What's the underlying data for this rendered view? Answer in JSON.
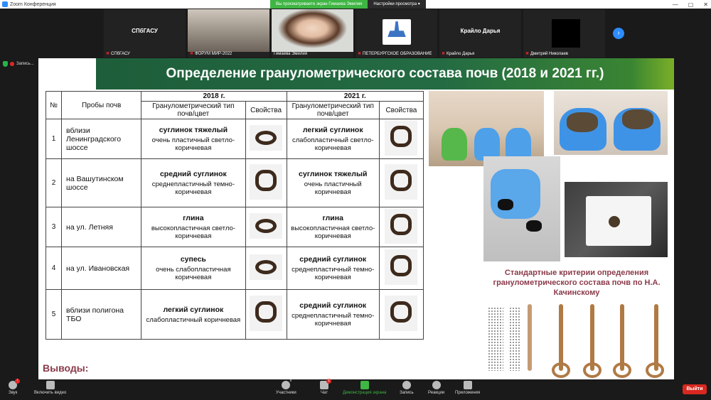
{
  "window": {
    "title": "Zoom Конференция"
  },
  "share_banner": {
    "text": "Вы просматриваете экран Гимаева Эмилия",
    "options_label": "Настройки просмотра ▾"
  },
  "window_controls": {
    "minimize": "—",
    "maximize": "▢",
    "close": "✕"
  },
  "gallery": {
    "tiles": [
      {
        "center_name": "СПбГАСУ",
        "label": "СПбГАСУ"
      },
      {
        "center_name": "",
        "label": "ФОРУМ МИР-2022"
      },
      {
        "center_name": "",
        "label": "Гимаева Эмилия"
      },
      {
        "center_name": "",
        "label": "ПЕТЕРБУРГСКОЕ ОБРАЗОВАНИЕ",
        "logo_text": "ПЕТЕРБУРГСКОЕ ОБРАЗОВАНИЕ"
      },
      {
        "center_name": "Крайло Дарья",
        "label": "Крайло Дарья"
      },
      {
        "center_name": "",
        "label": "Дмитрий Николаев"
      }
    ],
    "next_icon": "›"
  },
  "recording": {
    "label": "Запись..."
  },
  "slide": {
    "title": "Определение гранулометрического состава почв (2018 и 2021 гг.)",
    "table": {
      "head_no": "№",
      "head_samples": "Пробы почв",
      "year_2018": "2018 г.",
      "year_2021": "2021 г.",
      "sub_type": "Гранулометрический тип почв/цвет",
      "sub_props": "Свойства",
      "rows": [
        {
          "no": "1",
          "sample": "вблизи Ленинградского шоссе",
          "t2018": "суглинок тяжелый",
          "d2018": "очень пластичный светло-коричневая",
          "t2021": "легкий суглинок",
          "d2021": "слабопластичный светло-коричневая"
        },
        {
          "no": "2",
          "sample": "на Вашутинском шоссе",
          "t2018": "средний суглинок",
          "d2018": "среднепластичный темно-коричневая",
          "t2021": "суглинок тяжелый",
          "d2021": "очень пластичный коричневая"
        },
        {
          "no": "3",
          "sample": "на ул. Летняя",
          "t2018": "глина",
          "d2018": "высокопластичная светло-коричневая",
          "t2021": "глина",
          "d2021": "высокопластичная светло-коричневая"
        },
        {
          "no": "4",
          "sample": "на ул. Ивановская",
          "t2018": "супесь",
          "d2018": "очень слабопластичная коричневая",
          "t2021": "средний суглинок",
          "d2021": "среднепластичный темно-коричневая"
        },
        {
          "no": "5",
          "sample": "вблизи полигона ТБО",
          "t2018": "легкий суглинок",
          "d2018": "слабопластичный коричневая",
          "t2021": "средний суглинок",
          "d2021": "среднепластичный темно-коричневая"
        }
      ]
    },
    "criteria_title": "Стандартные критерии определения гранулометрического состава почв по Н.А. Качинскому",
    "conclusions": "Выводы:"
  },
  "toolbar": {
    "audio": "Звук",
    "video": "Включить видео",
    "participants": "Участники",
    "participants_count": "8",
    "chat": "Чат",
    "chat_badge": "1",
    "share": "Демонстрация экрана",
    "record": "Запись",
    "reactions": "Реакции",
    "apps": "Приложения",
    "leave": "Выйти"
  },
  "colors": {
    "accent": "#2d8cff",
    "share_green": "#3fb544",
    "leave_red": "#d9281f",
    "title_green": "#246b43",
    "criteria_text": "#8b3a4a"
  }
}
